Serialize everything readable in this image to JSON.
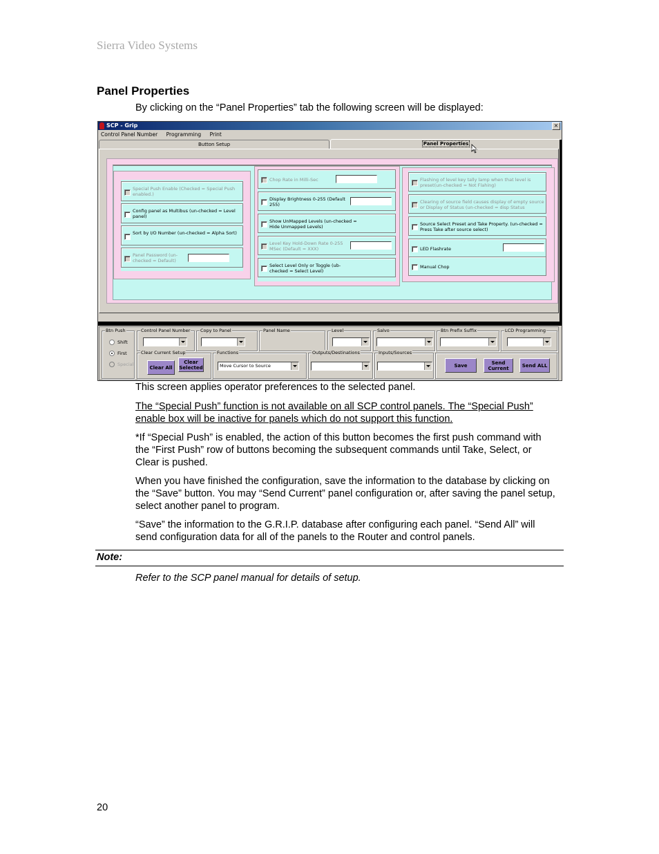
{
  "document": {
    "header_brand": "Sierra Video Systems",
    "section_title": "Panel Properties",
    "intro": "By clicking on the “Panel Properties” tab the following screen will be displayed:",
    "paragraphs": [
      "This screen applies operator preferences to the selected panel.",
      "The “Special Push” function is not available on all SCP control panels. The “Special Push” enable box will be inactive for panels which do not support this function.",
      "*If  “Special Push” is enabled, the action of this button becomes the first push command with the “First Push” row of buttons becoming the subsequent commands until Take, Select, or Clear is pushed.",
      "When you have finished the configuration, save the information to the database by clicking on the “Save” button. You may “Send Current” panel configuration or, after saving the panel setup, select another panel to program.",
      " “Save” the information to the G.R.I.P. database after configuring each panel. “Send All” will send configuration data for all of the panels to the Router and control panels."
    ],
    "note_label": "Note:",
    "note_text": "Refer to the SCP panel manual for details of setup.",
    "page_number": "20"
  },
  "app": {
    "title": "SCP  - Grip",
    "close_glyph": "×",
    "menu": [
      "Control Panel Number",
      "Programming",
      "Print"
    ],
    "tabs": [
      {
        "label": "Button Setup",
        "active": false
      },
      {
        "label": "Panel Properties",
        "active": true
      }
    ],
    "colors": {
      "pink": "#f8d2ea",
      "cyan": "#c4f7f1",
      "button_purple": "#9b86c8",
      "face": "#d4d0c8"
    },
    "groups": [
      {
        "options": [
          {
            "label": "Special Push Enable (Checked = Special Push enabled.)",
            "enabled": false,
            "checked": false,
            "has_input": false
          },
          {
            "label": "Config panel as Multibus (un-checked = Level panel)",
            "enabled": true,
            "checked": false,
            "has_input": false
          },
          {
            "label": "Sort by I/O  Number (un-checked = Alpha Sort)",
            "enabled": true,
            "checked": false,
            "has_input": false
          },
          {
            "label": "Panel Password (un-checked = Default)",
            "enabled": false,
            "checked": false,
            "has_input": true,
            "input_value": ""
          }
        ]
      },
      {
        "options": [
          {
            "label": "Chop Rate in Milli-Sec",
            "enabled": false,
            "checked": false,
            "has_input": true,
            "input_value": ""
          },
          {
            "label": "Display Brightness 0-255 (Default 255)",
            "enabled": true,
            "checked": false,
            "has_input": true,
            "input_value": ""
          },
          {
            "label": "Show UnMapped  Levels (un-checked = Hide Unmapped Levels)",
            "enabled": true,
            "checked": false,
            "has_input": false
          },
          {
            "label": "Level Key Hold-Down Rate 0-255 MSec (Default = XXX)",
            "enabled": false,
            "checked": false,
            "has_input": true,
            "input_value": ""
          },
          {
            "label": "Select Level Only or Toggle (ub-checked = Select Level)",
            "enabled": true,
            "checked": false,
            "has_input": false
          }
        ]
      },
      {
        "options": [
          {
            "label": "Flashing of level key tally lamp when that level is preset(un-checked = Not Flahing)",
            "enabled": false,
            "checked": false,
            "has_input": false
          },
          {
            "label": "Clearing of source field causes display of empty source or Display of Status (un-checked = disp Status",
            "enabled": false,
            "checked": false,
            "has_input": false
          },
          {
            "label": "Source Select Preset and Take Property. (un-checked = Press Take after source select)",
            "enabled": true,
            "checked": false,
            "has_input": false
          },
          {
            "label": "LED Flashrate",
            "enabled": true,
            "checked": false,
            "has_input": true,
            "input_value": ""
          },
          {
            "label": "Manual Chop",
            "enabled": true,
            "checked": false,
            "has_input": false
          }
        ]
      }
    ],
    "bottom": {
      "btn_push": {
        "legend": "Btn Push",
        "options": [
          {
            "label": "Shift",
            "selected": false,
            "enabled": true
          },
          {
            "label": "First",
            "selected": true,
            "enabled": true
          },
          {
            "label": "Special",
            "selected": false,
            "enabled": false
          }
        ]
      },
      "control_panel_number": {
        "legend": "Control Panel Number",
        "value": ""
      },
      "copy_to_panel": {
        "legend": "Copy to Panel",
        "value": ""
      },
      "panel_name": {
        "legend": "Panel Name",
        "value": ""
      },
      "level": {
        "legend": "Level",
        "value": ""
      },
      "salvo": {
        "legend": "Salvo",
        "value": ""
      },
      "btn_prefix_suffix": {
        "legend": "Btn Prefix Suffix",
        "value": ""
      },
      "lcd_programming": {
        "legend": "LCD Programming",
        "value": ""
      },
      "clear_current_setup": {
        "legend": "Clear Current Setup",
        "clear_all": "Clear All",
        "clear_selected": "Clear Selected"
      },
      "functions": {
        "legend": "Functions",
        "value": "Move Cursor to Source"
      },
      "outputs_destinations": {
        "legend": "Outputs/Destinations",
        "value": ""
      },
      "inputs_sources": {
        "legend": "Inputs/Sources",
        "value": ""
      },
      "save": "Save",
      "send_current": "Send Current",
      "send_all": "Send ALL"
    }
  }
}
